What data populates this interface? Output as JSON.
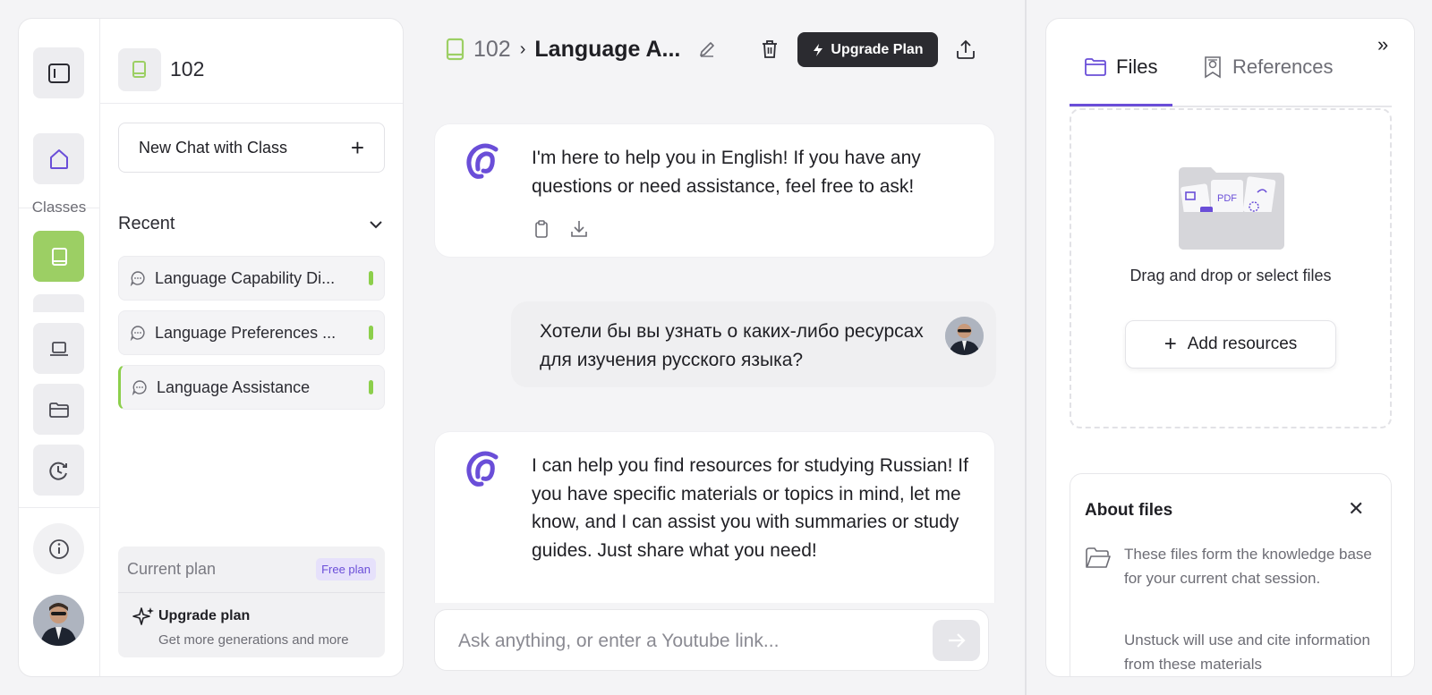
{
  "sidebar": {
    "classes_label": "Classes"
  },
  "class_panel": {
    "class_name": "102",
    "new_chat_label": "New Chat with Class",
    "recent_label": "Recent",
    "chats": [
      {
        "label": "Language Capability Di..."
      },
      {
        "label": "Language Preferences ..."
      },
      {
        "label": "Language Assistance"
      }
    ],
    "plan": {
      "current_label": "Current plan",
      "badge": "Free plan",
      "upgrade_title": "Upgrade plan",
      "upgrade_sub": "Get more generations and more"
    }
  },
  "header": {
    "class_num": "102",
    "separator": "›",
    "chat_title": "Language A...",
    "upgrade_label": "Upgrade Plan"
  },
  "messages": [
    {
      "role": "bot",
      "text": "I'm here to help you in English! If you have any questions or need assistance, feel free to ask!"
    },
    {
      "role": "user",
      "text": "Хотели бы вы узнать о каких-либо ресурсах для изучения русского языка?"
    },
    {
      "role": "bot",
      "text": "I can help you find resources for studying Russian! If you have specific materials or topics in mind, let me know, and I can assist you with summaries or study guides. Just share what you need!"
    }
  ],
  "input": {
    "placeholder": "Ask anything, or enter a Youtube link..."
  },
  "right_panel": {
    "tabs": [
      {
        "label": "Files"
      },
      {
        "label": "References"
      }
    ],
    "drop_text": "Drag and drop or select files",
    "add_resources_label": "Add resources",
    "about": {
      "title": "About files",
      "text1": "These files form the knowledge base for your current chat session.",
      "text2": "Unstuck will use and cite information from these materials"
    }
  },
  "colors": {
    "accent_purple": "#6a4ed8",
    "class_green": "#9ccf64",
    "dark_button": "#2b2b30"
  }
}
